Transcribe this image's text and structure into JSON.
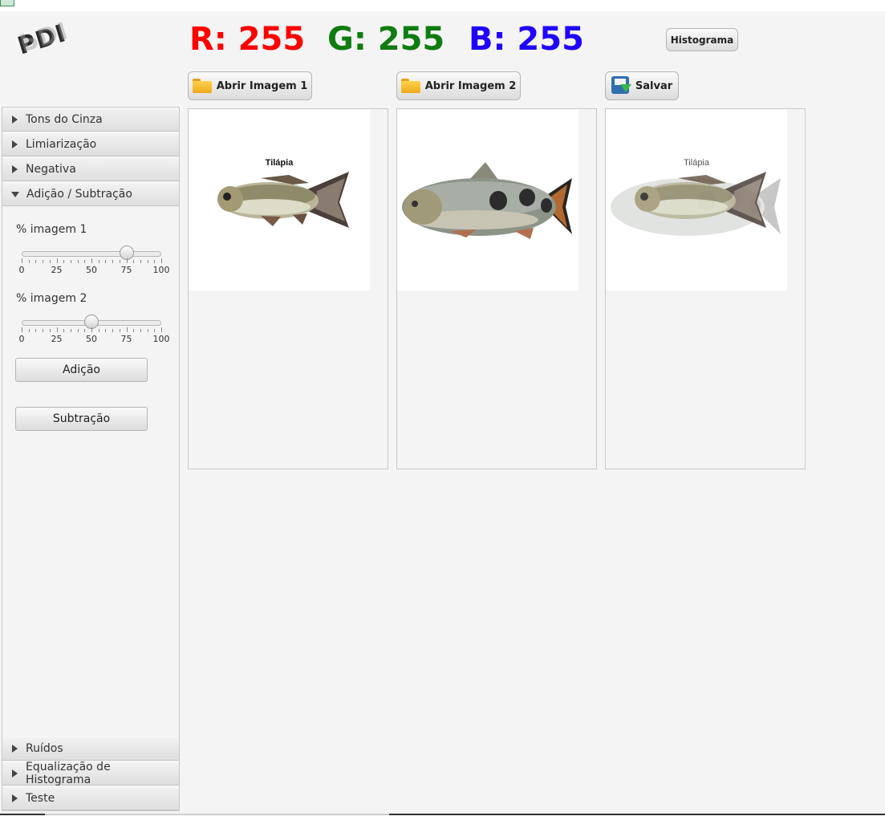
{
  "logo": {
    "text": "PDI"
  },
  "rgb": {
    "r": "R: 255",
    "g": "G: 255",
    "b": "B: 255"
  },
  "toolbar": {
    "histogram_label": "Histograma",
    "open_image1_label": "Abrir Imagem 1",
    "open_image2_label": "Abrir Imagem 2",
    "save_label": "Salvar"
  },
  "sidebar": {
    "sections": [
      {
        "label": "Tons do Cinza",
        "expanded": false
      },
      {
        "label": "Limiarização",
        "expanded": false
      },
      {
        "label": "Negativa",
        "expanded": false
      },
      {
        "label": "Adição / Subtração",
        "expanded": true
      },
      {
        "label": "Ruídos",
        "expanded": false
      },
      {
        "label": "Equalização de Histograma",
        "expanded": false
      },
      {
        "label": "Teste",
        "expanded": false
      }
    ],
    "blend_panel": {
      "image1_label": "% imagem 1",
      "image1_value": 75,
      "image2_label": "% imagem 2",
      "image2_value": 50,
      "slider_min": 0,
      "slider_max": 100,
      "tick_labels": [
        "0",
        "25",
        "50",
        "75",
        "100"
      ],
      "add_button": "Adição",
      "subtract_button": "Subtração"
    }
  },
  "images": {
    "image1_caption": "Tilápia",
    "result_caption": "Tilápia"
  },
  "colors": {
    "r": "#ff0000",
    "g": "#107c10",
    "b": "#2000ff"
  },
  "icons": {
    "open": "folder-icon",
    "save": "floppy-disk-icon",
    "collapsed": "triangle-right-icon",
    "expanded": "triangle-down-icon"
  }
}
